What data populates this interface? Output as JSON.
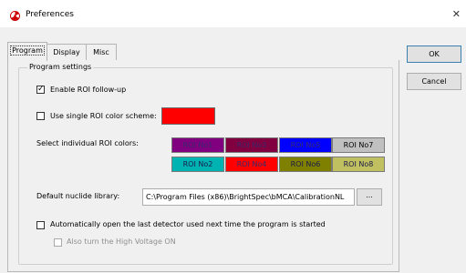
{
  "window": {
    "title": "Preferences",
    "close_glyph": "✕"
  },
  "tabs": [
    {
      "label": "Program",
      "active": true
    },
    {
      "label": "Display",
      "active": false
    },
    {
      "label": "Misc",
      "active": false
    }
  ],
  "group": {
    "legend": "Program settings"
  },
  "settings": {
    "enable_roi_followup": {
      "label": "Enable ROI follow-up",
      "checked": true
    },
    "single_color": {
      "label": "Use single ROI color scheme:",
      "checked": false,
      "color": "#ff0000"
    },
    "individual_colors_label": "Select individual ROI colors:",
    "roi_buttons": [
      {
        "label": "ROI No1",
        "bg": "#800080",
        "fg": "#3a2a6a"
      },
      {
        "label": "ROI No3",
        "bg": "#800040",
        "fg": "#3a2a6a"
      },
      {
        "label": "ROI No5",
        "bg": "#0000ff",
        "fg": "#3a2a6a"
      },
      {
        "label": "ROI No7",
        "bg": "#c0c0c0",
        "fg": "#000000"
      },
      {
        "label": "ROI No2",
        "bg": "#00b3b3",
        "fg": "#1a1a4a"
      },
      {
        "label": "ROI No4",
        "bg": "#ff0000",
        "fg": "#3a2a6a"
      },
      {
        "label": "ROI No6",
        "bg": "#808000",
        "fg": "#1a1a4a"
      },
      {
        "label": "ROI No8",
        "bg": "#c0c060",
        "fg": "#1a1a4a"
      }
    ],
    "nuclide_library": {
      "label": "Default nuclide library:",
      "value": "C:\\Program Files (x86)\\BrightSpec\\bMCA\\CalibrationNL",
      "browse_label": "..."
    },
    "auto_open_detector": {
      "label": "Automatically open the last detector used next time the program is started",
      "checked": false
    },
    "high_voltage": {
      "label": "Also turn the High Voltage ON",
      "checked": false,
      "disabled": true
    }
  },
  "buttons": {
    "ok": "OK",
    "cancel": "Cancel"
  },
  "icons": {
    "app": "radiation-icon",
    "check": "check-icon"
  }
}
